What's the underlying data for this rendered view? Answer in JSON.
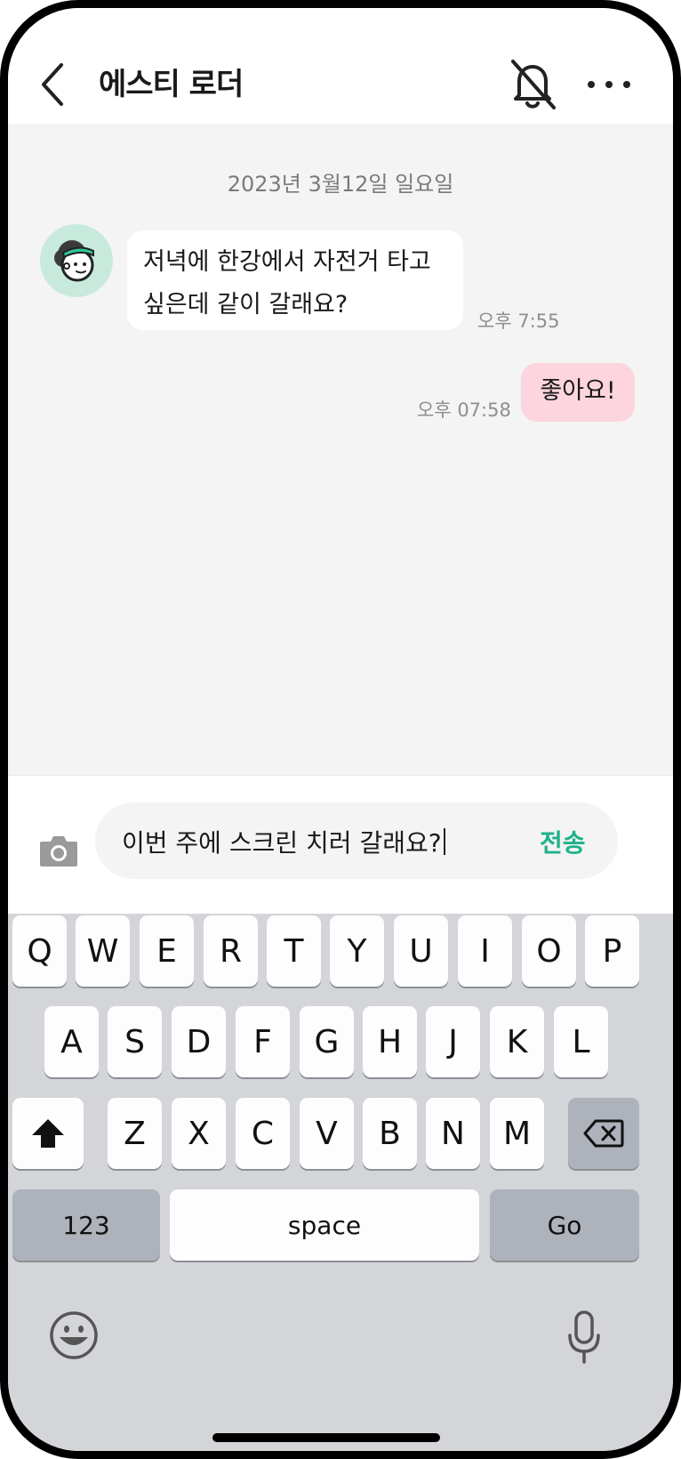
{
  "header": {
    "contact_name": "에스티 로더",
    "back_icon": "chevron-left-icon",
    "mute_icon": "bell-off-icon",
    "more_icon": "more-horizontal-icon"
  },
  "chat": {
    "date_label": "2023년 3월12일 일요일",
    "messages": [
      {
        "direction": "incoming",
        "avatar_icon": "character-avatar-icon",
        "lines": [
          "저녁에 한강에서 자전거 타고",
          "싶은데 같이 갈래요?"
        ],
        "time": "오후 7:55"
      },
      {
        "direction": "outgoing",
        "text": "좋아요!",
        "time": "오후 07:58"
      }
    ],
    "colors": {
      "outgoing_bubble": "#fdd5df",
      "incoming_bubble": "#ffffff",
      "background": "#f4f4f4"
    }
  },
  "composer": {
    "camera_icon": "camera-icon",
    "input_value": "이번 주에 스크린 치러 갈래요?",
    "send_label": "전송",
    "accent": "#1fb28a"
  },
  "keyboard": {
    "row1": [
      "Q",
      "W",
      "E",
      "R",
      "T",
      "Y",
      "U",
      "I",
      "O",
      "P"
    ],
    "row2": [
      "A",
      "S",
      "D",
      "F",
      "G",
      "H",
      "J",
      "K",
      "L"
    ],
    "row3": [
      "Z",
      "X",
      "C",
      "V",
      "B",
      "N",
      "M"
    ],
    "shift_icon": "shift-icon",
    "backspace_icon": "backspace-icon",
    "numbers_label": "123",
    "space_label": "space",
    "go_label": "Go",
    "emoji_icon": "emoji-icon",
    "mic_icon": "microphone-icon"
  }
}
